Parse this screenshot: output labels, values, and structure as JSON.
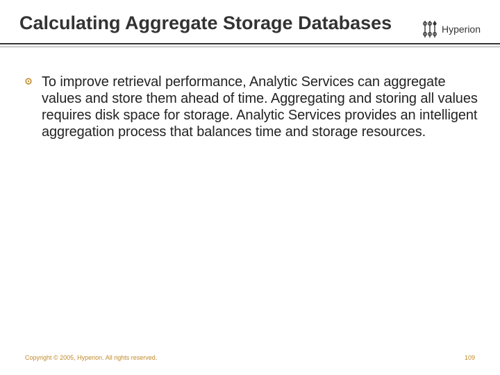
{
  "header": {
    "title": "Calculating Aggregate Storage Databases",
    "brand": "Hyperion"
  },
  "body": {
    "items": [
      {
        "text": "To improve retrieval performance, Analytic Services can aggregate values and store them ahead of time. Aggregating and storing all values requires disk space for storage. Analytic Services provides an intelligent aggregation process that balances time and storage resources."
      }
    ]
  },
  "footer": {
    "copyright": "Copyright © 2005, Hyperion. All rights reserved.",
    "page": "109"
  },
  "colors": {
    "accent": "#c08a2a"
  }
}
